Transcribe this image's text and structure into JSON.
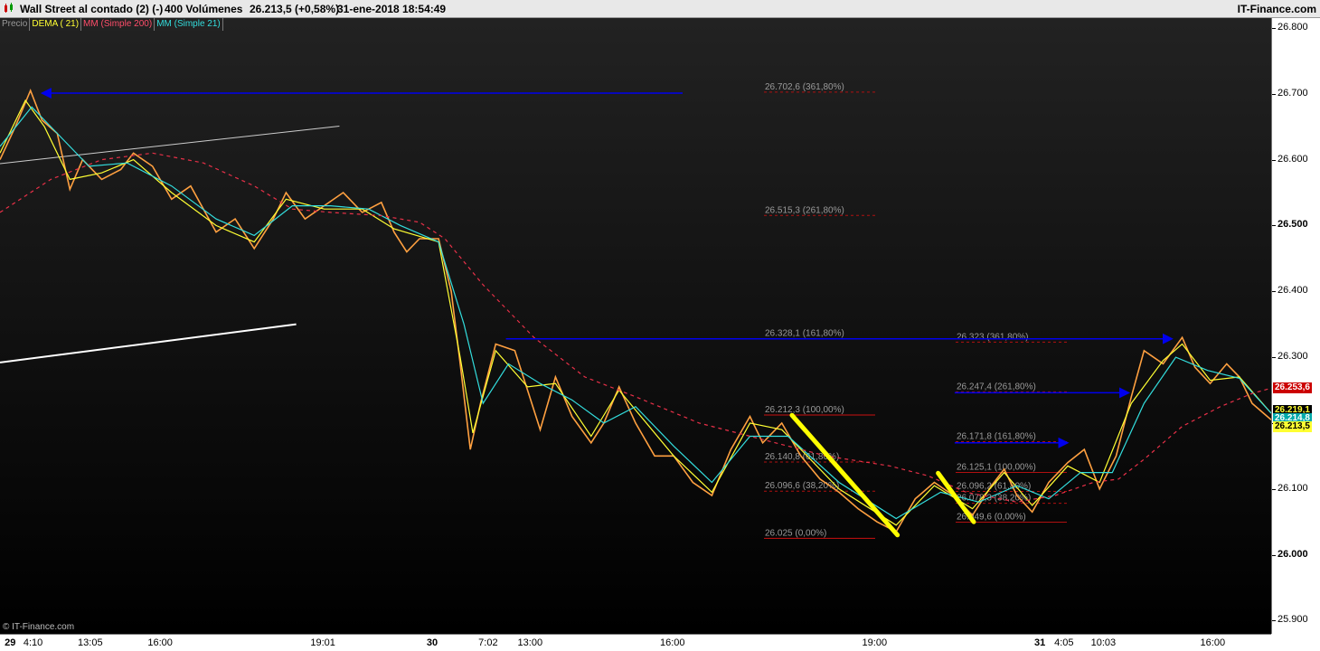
{
  "header": {
    "title": "Wall Street al contado (2) (-)",
    "volume": "400 Volúmenes",
    "price_change": "26.213,5 (+0,58%)",
    "datetime": "31-ene-2018 18:54:49",
    "brand": "IT-Finance.com"
  },
  "legend": [
    {
      "label": "Precio",
      "color": "#999999"
    },
    {
      "label": "DEMA ( 21)",
      "color": "#ffff33"
    },
    {
      "label": "MM (Simple 200)",
      "color": "#ff4d6a"
    },
    {
      "label": "MM (Simple 21)",
      "color": "#33dddd"
    }
  ],
  "watermark": "© IT-Finance.com",
  "price_boxes": [
    {
      "label": "26.253,6",
      "value": 26253.6,
      "bg": "#cc0000",
      "fg": "#ffffff"
    },
    {
      "label": "26.219,1",
      "value": 26219.1,
      "bg": "#000000",
      "fg": "#ffff33"
    },
    {
      "label": "26.214,8",
      "value": 26214.8,
      "bg": "#00aaaa",
      "fg": "#ffffff"
    },
    {
      "label": "26.213,5",
      "value": 26213.5,
      "bg": "#ffff33",
      "fg": "#000000"
    }
  ],
  "chart_data": {
    "type": "line",
    "ylim": [
      25880,
      26815
    ],
    "y_ticks": [
      "26.800",
      "26.700",
      "26.600",
      "26.500",
      "26.400",
      "26.300",
      "26.200",
      "26.100",
      "26.000",
      "25.900"
    ],
    "y_tick_values": [
      26800,
      26700,
      26600,
      26500,
      26400,
      26300,
      26200,
      26100,
      26000,
      25900
    ],
    "y_tick_bold": [
      false,
      false,
      false,
      true,
      false,
      false,
      false,
      false,
      true,
      false
    ],
    "x_ticks": [
      {
        "label": "29",
        "bold": true,
        "t": 0.008
      },
      {
        "label": "4:10",
        "bold": false,
        "t": 0.026
      },
      {
        "label": "13:05",
        "bold": false,
        "t": 0.071
      },
      {
        "label": "16:00",
        "bold": false,
        "t": 0.126
      },
      {
        "label": "19:01",
        "bold": false,
        "t": 0.254
      },
      {
        "label": "30",
        "bold": true,
        "t": 0.34
      },
      {
        "label": "7:02",
        "bold": false,
        "t": 0.384
      },
      {
        "label": "13:00",
        "bold": false,
        "t": 0.417
      },
      {
        "label": "16:00",
        "bold": false,
        "t": 0.529
      },
      {
        "label": "19:00",
        "bold": false,
        "t": 0.688
      },
      {
        "label": "31",
        "bold": true,
        "t": 0.818
      },
      {
        "label": "4:05",
        "bold": false,
        "t": 0.837
      },
      {
        "label": "10:03",
        "bold": false,
        "t": 0.868
      },
      {
        "label": "16:00",
        "bold": false,
        "t": 0.954
      }
    ],
    "series": [
      {
        "name": "Precio",
        "color": "#ffa040",
        "points": [
          [
            0,
            26600
          ],
          [
            0.012,
            26650
          ],
          [
            0.024,
            26705
          ],
          [
            0.033,
            26660
          ],
          [
            0.045,
            26640
          ],
          [
            0.055,
            26555
          ],
          [
            0.065,
            26600
          ],
          [
            0.08,
            26570
          ],
          [
            0.095,
            26585
          ],
          [
            0.105,
            26610
          ],
          [
            0.12,
            26590
          ],
          [
            0.135,
            26540
          ],
          [
            0.15,
            26560
          ],
          [
            0.17,
            26490
          ],
          [
            0.185,
            26510
          ],
          [
            0.2,
            26465
          ],
          [
            0.215,
            26510
          ],
          [
            0.225,
            26550
          ],
          [
            0.24,
            26510
          ],
          [
            0.255,
            26530
          ],
          [
            0.27,
            26550
          ],
          [
            0.285,
            26520
          ],
          [
            0.3,
            26535
          ],
          [
            0.31,
            26490
          ],
          [
            0.32,
            26460
          ],
          [
            0.33,
            26480
          ],
          [
            0.345,
            26480
          ],
          [
            0.355,
            26400
          ],
          [
            0.362,
            26290
          ],
          [
            0.37,
            26160
          ],
          [
            0.378,
            26230
          ],
          [
            0.39,
            26320
          ],
          [
            0.405,
            26310
          ],
          [
            0.415,
            26250
          ],
          [
            0.425,
            26190
          ],
          [
            0.437,
            26270
          ],
          [
            0.45,
            26210
          ],
          [
            0.465,
            26170
          ],
          [
            0.475,
            26200
          ],
          [
            0.487,
            26255
          ],
          [
            0.5,
            26200
          ],
          [
            0.515,
            26150
          ],
          [
            0.53,
            26150
          ],
          [
            0.545,
            26110
          ],
          [
            0.56,
            26090
          ],
          [
            0.575,
            26160
          ],
          [
            0.59,
            26210
          ],
          [
            0.6,
            26170
          ],
          [
            0.615,
            26200
          ],
          [
            0.63,
            26150
          ],
          [
            0.645,
            26115
          ],
          [
            0.66,
            26095
          ],
          [
            0.675,
            26070
          ],
          [
            0.69,
            26050
          ],
          [
            0.705,
            26035
          ],
          [
            0.72,
            26085
          ],
          [
            0.735,
            26110
          ],
          [
            0.75,
            26090
          ],
          [
            0.765,
            26060
          ],
          [
            0.78,
            26105
          ],
          [
            0.79,
            26130
          ],
          [
            0.8,
            26090
          ],
          [
            0.812,
            26065
          ],
          [
            0.825,
            26110
          ],
          [
            0.84,
            26140
          ],
          [
            0.853,
            26160
          ],
          [
            0.865,
            26100
          ],
          [
            0.878,
            26150
          ],
          [
            0.89,
            26240
          ],
          [
            0.9,
            26310
          ],
          [
            0.915,
            26290
          ],
          [
            0.93,
            26330
          ],
          [
            0.94,
            26285
          ],
          [
            0.952,
            26260
          ],
          [
            0.965,
            26290
          ],
          [
            0.975,
            26270
          ],
          [
            0.985,
            26230
          ],
          [
            1,
            26205
          ]
        ]
      },
      {
        "name": "DEMA ( 21)",
        "color": "#ffff33",
        "points": [
          [
            0,
            26610
          ],
          [
            0.02,
            26690
          ],
          [
            0.035,
            26650
          ],
          [
            0.055,
            26570
          ],
          [
            0.08,
            26580
          ],
          [
            0.105,
            26600
          ],
          [
            0.135,
            26550
          ],
          [
            0.17,
            26500
          ],
          [
            0.2,
            26475
          ],
          [
            0.225,
            26540
          ],
          [
            0.255,
            26525
          ],
          [
            0.285,
            26525
          ],
          [
            0.31,
            26495
          ],
          [
            0.345,
            26475
          ],
          [
            0.362,
            26300
          ],
          [
            0.372,
            26185
          ],
          [
            0.39,
            26310
          ],
          [
            0.415,
            26255
          ],
          [
            0.437,
            26260
          ],
          [
            0.465,
            26180
          ],
          [
            0.487,
            26250
          ],
          [
            0.53,
            26150
          ],
          [
            0.56,
            26095
          ],
          [
            0.59,
            26200
          ],
          [
            0.615,
            26190
          ],
          [
            0.66,
            26100
          ],
          [
            0.705,
            26045
          ],
          [
            0.735,
            26105
          ],
          [
            0.765,
            26070
          ],
          [
            0.79,
            26125
          ],
          [
            0.812,
            26075
          ],
          [
            0.84,
            26135
          ],
          [
            0.865,
            26110
          ],
          [
            0.89,
            26230
          ],
          [
            0.915,
            26295
          ],
          [
            0.93,
            26320
          ],
          [
            0.952,
            26265
          ],
          [
            0.975,
            26270
          ],
          [
            1,
            26215
          ]
        ]
      },
      {
        "name": "MM (Simple 21)",
        "color": "#33dddd",
        "points": [
          [
            0,
            26620
          ],
          [
            0.025,
            26680
          ],
          [
            0.045,
            26640
          ],
          [
            0.07,
            26590
          ],
          [
            0.1,
            26595
          ],
          [
            0.135,
            26560
          ],
          [
            0.17,
            26510
          ],
          [
            0.2,
            26485
          ],
          [
            0.23,
            26530
          ],
          [
            0.26,
            26530
          ],
          [
            0.29,
            26525
          ],
          [
            0.315,
            26500
          ],
          [
            0.345,
            26475
          ],
          [
            0.365,
            26350
          ],
          [
            0.38,
            26230
          ],
          [
            0.4,
            26290
          ],
          [
            0.425,
            26260
          ],
          [
            0.45,
            26235
          ],
          [
            0.475,
            26200
          ],
          [
            0.5,
            26225
          ],
          [
            0.53,
            26165
          ],
          [
            0.56,
            26110
          ],
          [
            0.59,
            26180
          ],
          [
            0.62,
            26180
          ],
          [
            0.66,
            26110
          ],
          [
            0.705,
            26055
          ],
          [
            0.74,
            26095
          ],
          [
            0.77,
            26080
          ],
          [
            0.8,
            26105
          ],
          [
            0.825,
            26085
          ],
          [
            0.85,
            26125
          ],
          [
            0.875,
            26125
          ],
          [
            0.9,
            26230
          ],
          [
            0.925,
            26300
          ],
          [
            0.95,
            26280
          ],
          [
            0.975,
            26268
          ],
          [
            1,
            26215
          ]
        ]
      },
      {
        "name": "MM (Simple 200)",
        "color": "#e83048",
        "dashed": true,
        "points": [
          [
            0,
            26520
          ],
          [
            0.04,
            26570
          ],
          [
            0.08,
            26600
          ],
          [
            0.12,
            26610
          ],
          [
            0.16,
            26595
          ],
          [
            0.2,
            26560
          ],
          [
            0.23,
            26525
          ],
          [
            0.26,
            26520
          ],
          [
            0.3,
            26515
          ],
          [
            0.33,
            26505
          ],
          [
            0.35,
            26480
          ],
          [
            0.38,
            26410
          ],
          [
            0.42,
            26330
          ],
          [
            0.46,
            26270
          ],
          [
            0.5,
            26240
          ],
          [
            0.55,
            26200
          ],
          [
            0.6,
            26175
          ],
          [
            0.65,
            26150
          ],
          [
            0.7,
            26135
          ],
          [
            0.73,
            26120
          ],
          [
            0.76,
            26095
          ],
          [
            0.8,
            26080
          ],
          [
            0.83,
            26090
          ],
          [
            0.86,
            26110
          ],
          [
            0.88,
            26115
          ],
          [
            0.9,
            26145
          ],
          [
            0.93,
            26195
          ],
          [
            0.96,
            26225
          ],
          [
            0.985,
            26245
          ],
          [
            1,
            26253
          ]
        ]
      }
    ],
    "fib_left": [
      {
        "label": "26.702,6 (361,80%)",
        "value": 26702.6
      },
      {
        "label": "26.515,3 (261,80%)",
        "value": 26515.3
      },
      {
        "label": "26.328,1 (161,80%)",
        "value": 26328.1
      },
      {
        "label": "26.212,3 (100,00%)",
        "value": 26212.3
      },
      {
        "label": "26.140,8 (61,80%)",
        "value": 26140.8
      },
      {
        "label": "26.096,6 (38,20%)",
        "value": 26096.6
      },
      {
        "label": "26.025 (0,00%)",
        "value": 26025
      }
    ],
    "fib_right": [
      {
        "label": "26.323 (361,80%)",
        "value": 26323
      },
      {
        "label": "26.247,4 (261,80%)",
        "value": 26247.4
      },
      {
        "label": "26.171,8 (161,80%)",
        "value": 26171.8
      },
      {
        "label": "26.125,1 (100,00%)",
        "value": 26125.1
      },
      {
        "label": "26.096,2 (61,80%)",
        "value": 26096.2
      },
      {
        "label": "26.078,3 (38,20%)",
        "value": 26078.3
      },
      {
        "label": "26.049,6 (0,00%)",
        "value": 26049.6
      }
    ],
    "trendlines": [
      {
        "name": "upper-channel",
        "color": "#cccccc",
        "from": [
          0,
          26594
        ],
        "to": [
          0.267,
          26651
        ]
      },
      {
        "name": "lower-channel",
        "color": "#ffffff",
        "from": [
          0,
          26292
        ],
        "to": [
          0.233,
          26350
        ]
      }
    ],
    "arrows": [
      {
        "name": "arrow-26702",
        "color": "#0000ee",
        "from": [
          0.537,
          26701
        ],
        "to": [
          0.033,
          26701
        ]
      },
      {
        "name": "arrow-26328",
        "color": "#0000ee",
        "from": [
          0.398,
          26328
        ],
        "to": [
          0.922,
          26328
        ]
      },
      {
        "name": "arrow-26247",
        "color": "#0000ee",
        "from": [
          0.751,
          26246
        ],
        "to": [
          0.888,
          26246
        ]
      },
      {
        "name": "arrow-26171",
        "color": "#0000ee",
        "from": [
          0.751,
          26170
        ],
        "to": [
          0.84,
          26170
        ]
      }
    ],
    "swing_lines": [
      {
        "name": "swing-down-1",
        "color": "#ffff00",
        "from": [
          0.623,
          26212
        ],
        "to": [
          0.706,
          26030
        ]
      },
      {
        "name": "swing-down-2",
        "color": "#ffff00",
        "from": [
          0.738,
          26124
        ],
        "to": [
          0.766,
          26050
        ]
      }
    ]
  }
}
